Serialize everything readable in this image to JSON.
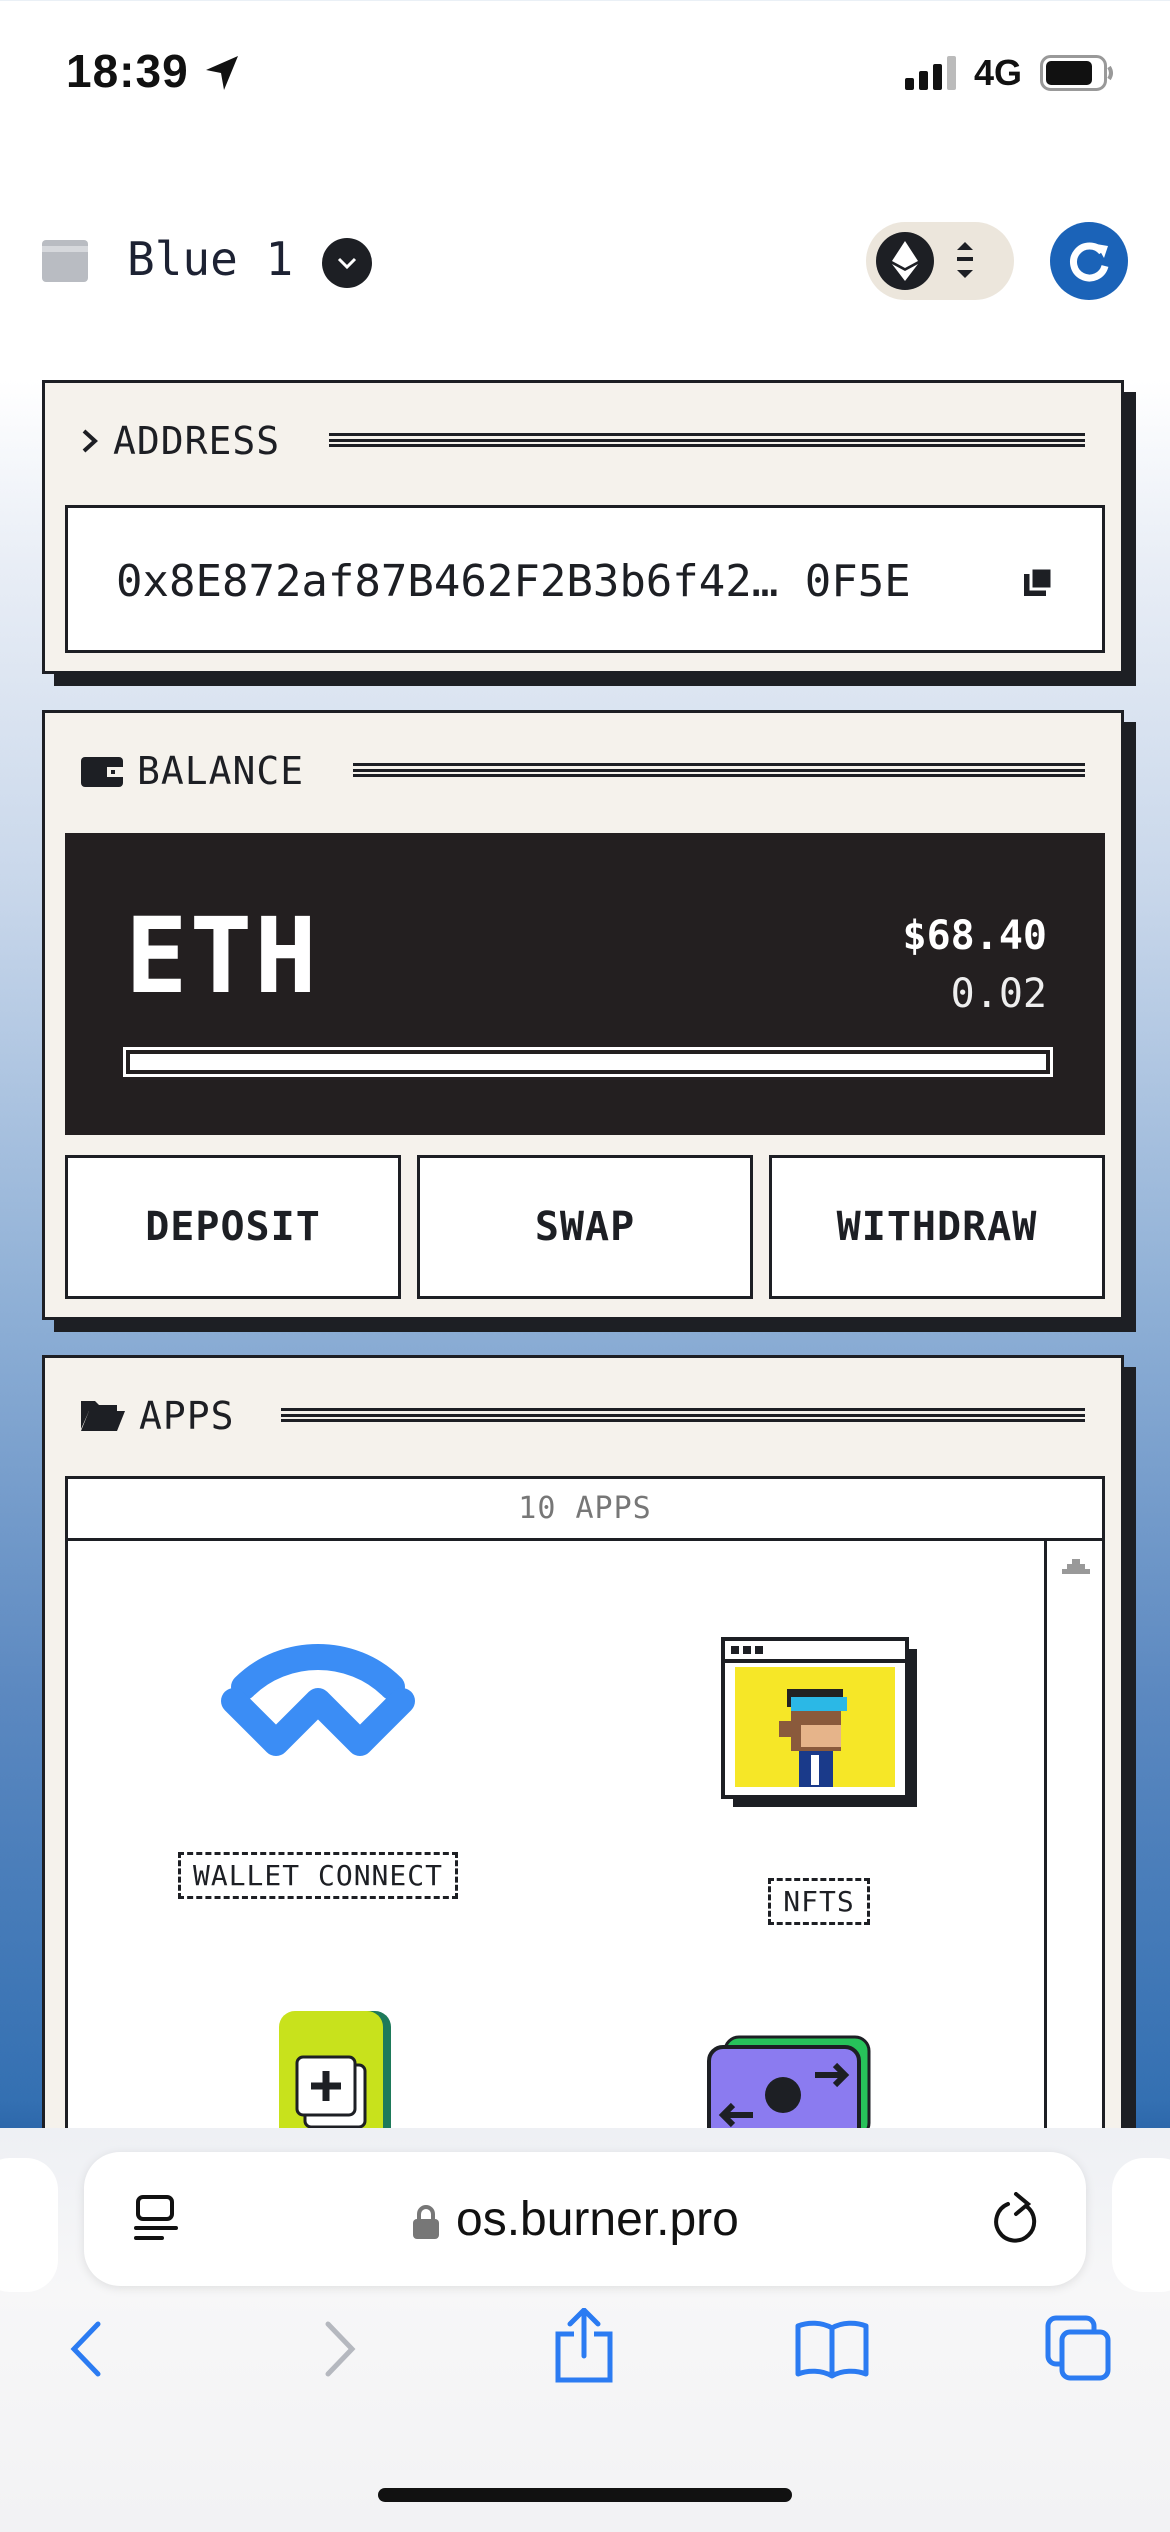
{
  "status_bar": {
    "time": "18:39",
    "network": "4G"
  },
  "header": {
    "wallet_name": "Blue 1"
  },
  "address_card": {
    "title": "ADDRESS",
    "address": "0x8E872af87B462F2B3b6f42… 0F5E"
  },
  "balance_card": {
    "title": "BALANCE",
    "token": "ETH",
    "usd_value": "$68.40",
    "amount": "0.02",
    "progress_fraction": 1.0,
    "buttons": {
      "deposit": "DEPOSIT",
      "swap": "SWAP",
      "withdraw": "WITHDRAW"
    }
  },
  "apps_card": {
    "title": "APPS",
    "count_label": "10 APPS",
    "apps": [
      {
        "label": "WALLET CONNECT",
        "icon": "walletconnect-icon"
      },
      {
        "label": "NFTS",
        "icon": "nft-ape-icon"
      },
      {
        "label": "",
        "icon": "green-add-card-icon"
      },
      {
        "label": "",
        "icon": "purple-swap-card-icon"
      }
    ]
  },
  "browser": {
    "url": "os.burner.pro"
  },
  "colors": {
    "accent_blue": "#1b63b8",
    "dark": "#1d1f24",
    "card_bg": "#f5f2ec"
  }
}
